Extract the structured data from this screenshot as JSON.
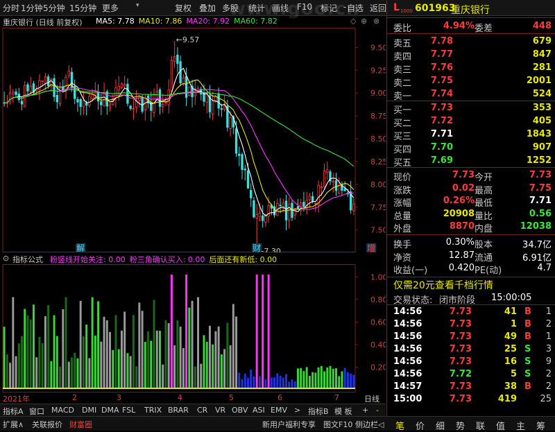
{
  "toolbar": {
    "tabs": [
      "分时",
      "1分钟",
      "5分钟",
      "15分钟",
      "更多"
    ],
    "more_arrow": "▾",
    "actions": [
      "复权",
      "叠加",
      "多股",
      "统计",
      "画线",
      "F10",
      "标记",
      "自选",
      "返回"
    ],
    "action_prefix": "-",
    "watermark": "www.goo.cn"
  },
  "chart_header": {
    "title": "重庆银行 (日线 前复权)",
    "ma": [
      {
        "label": "MA5: 7.78",
        "color": "#ffffff"
      },
      {
        "label": "MA10: 7.86",
        "color": "#e8e800"
      },
      {
        "label": "MA20: 7.92",
        "color": "#ff33ff"
      },
      {
        "label": "MA60: 7.82",
        "color": "#39e639"
      }
    ]
  },
  "chart_data": [
    {
      "type": "candlestick",
      "y_ticks": [
        9.5,
        9.25,
        9.0,
        8.75,
        8.5,
        8.25,
        8.0,
        7.75,
        7.5
      ],
      "ylim": [
        7.3,
        9.7
      ],
      "annotations": {
        "high": "9.57",
        "low": "7.30",
        "high_marker": "←9.57",
        "low_marker": "←7.30"
      },
      "markers": [
        "解",
        "财",
        "增"
      ],
      "n_bars": 120,
      "close_anchors": [
        [
          0,
          8.92
        ],
        [
          8,
          8.98
        ],
        [
          14,
          9.2
        ],
        [
          18,
          8.95
        ],
        [
          22,
          9.3
        ],
        [
          25,
          8.8
        ],
        [
          30,
          9.0
        ],
        [
          36,
          8.9
        ],
        [
          40,
          9.05
        ],
        [
          44,
          8.85
        ],
        [
          50,
          8.9
        ],
        [
          55,
          8.95
        ],
        [
          58,
          9.4
        ],
        [
          62,
          8.95
        ],
        [
          66,
          9.0
        ],
        [
          70,
          8.9
        ],
        [
          74,
          8.88
        ],
        [
          78,
          8.55
        ],
        [
          82,
          8.05
        ],
        [
          86,
          7.62
        ],
        [
          90,
          7.72
        ],
        [
          94,
          7.68
        ],
        [
          98,
          7.72
        ],
        [
          102,
          7.78
        ],
        [
          106,
          7.9
        ],
        [
          110,
          8.1
        ],
        [
          114,
          8.0
        ],
        [
          119,
          7.73
        ]
      ],
      "ma_colors": {
        "ma5": "#ffffff",
        "ma10": "#e8e800",
        "ma20": "#ff33ff",
        "ma60": "#39e639"
      }
    },
    {
      "type": "bar",
      "title": "指标公式",
      "legend": [
        {
          "label": "粉竖线开始关注: 0.00",
          "color": "#ff33ff"
        },
        {
          "label": "粉三角确认买入: 0.00",
          "color": "#ff33ff"
        },
        {
          "label": "后面还有新低: 0.00",
          "color": "#e8e800"
        }
      ],
      "y_ticks": [
        1.0,
        0.8,
        0.6,
        0.4,
        0.2
      ],
      "ylim": [
        0,
        1.1
      ],
      "pink_spikes": [
        57,
        62,
        86,
        88,
        90
      ],
      "x_labels": [
        "2021年",
        "2",
        "3",
        "4",
        "5",
        "6",
        "7"
      ]
    }
  ],
  "bottom_tabs": [
    "指标A",
    "窗口",
    "MACD",
    "DMI",
    "DMA",
    "FSL",
    "TRIX",
    "BRAR",
    "CR",
    "VR",
    "OBV",
    "ASI",
    "EMV",
    "指标B",
    "模 板",
    "+",
    "-"
  ],
  "bottom_arrow": ">",
  "x_range_label": "日线",
  "footer": {
    "left": [
      "扩展∧",
      "关联报价",
      "财富圈"
    ],
    "middle": [
      "新用户福利专享",
      "图文F10",
      "侧边栏◁"
    ],
    "right": [
      "笔",
      "价",
      "细",
      "势",
      "联",
      "值",
      "主",
      "筹"
    ]
  },
  "quote": {
    "code": "601963",
    "name": "重庆银行",
    "l_badge": "L",
    "l_sub": "1000",
    "weibi": {
      "label": "委比",
      "value": "4.94%",
      "diff_label": "委差",
      "diff": "448"
    },
    "asks": [
      {
        "label": "卖五",
        "price": "7.78",
        "vol": "679"
      },
      {
        "label": "卖四",
        "price": "7.77",
        "vol": "847"
      },
      {
        "label": "卖三",
        "price": "7.76",
        "vol": "281"
      },
      {
        "label": "卖二",
        "price": "7.75",
        "vol": "2001"
      },
      {
        "label": "卖一",
        "price": "7.74",
        "vol": "524"
      }
    ],
    "bids": [
      {
        "label": "买一",
        "price": "7.73",
        "vol": "353",
        "color": "#ff3b3b"
      },
      {
        "label": "买二",
        "price": "7.72",
        "vol": "405",
        "color": "#ff3b3b"
      },
      {
        "label": "买三",
        "price": "7.71",
        "vol": "1843",
        "color": "#ffffff"
      },
      {
        "label": "买四",
        "price": "7.70",
        "vol": "907",
        "color": "#39e639"
      },
      {
        "label": "买五",
        "price": "7.69",
        "vol": "1252",
        "color": "#39e639"
      }
    ],
    "stats": [
      {
        "l1": "现价",
        "v1": "7.73",
        "c1": "#ff3b3b",
        "l2": "今开",
        "v2": "7.73",
        "c2": "#ff3b3b"
      },
      {
        "l1": "涨跌",
        "v1": "0.02",
        "c1": "#ff3b3b",
        "l2": "最高",
        "v2": "7.75",
        "c2": "#ff3b3b"
      },
      {
        "l1": "涨幅",
        "v1": "0.26%",
        "c1": "#ff3b3b",
        "l2": "最低",
        "v2": "7.71",
        "c2": "#ffffff"
      },
      {
        "l1": "总量",
        "v1": "20908",
        "c1": "#e8e800",
        "l2": "量比",
        "v2": "0.56",
        "c2": "#39e639"
      },
      {
        "l1": "外盘",
        "v1": "8870",
        "c1": "#ff3b3b",
        "l2": "内盘",
        "v2": "12038",
        "c2": "#39e639"
      }
    ],
    "stats2": [
      {
        "l1": "换手",
        "v1": "0.30%",
        "l2": "股本",
        "v2": "34.7亿"
      },
      {
        "l1": "净资",
        "v1": "12.87",
        "l2": "流通",
        "v2": "6.91亿"
      },
      {
        "l1": "收益(一)",
        "v1": "0.420",
        "l2": "PE(动)",
        "v2": "4.7"
      }
    ],
    "promo": "仅需20元查看千档行情",
    "status": {
      "label": "交易状态:",
      "phase": "闭市阶段",
      "time": "15:00:05"
    },
    "ticks": [
      {
        "t": "14:56",
        "p": "7.73",
        "v": "41",
        "f": "B"
      },
      {
        "t": "14:56",
        "p": "7.73",
        "v": "1",
        "f": "B"
      },
      {
        "t": "14:56",
        "p": "7.73",
        "v": "49",
        "f": "B"
      },
      {
        "t": "14:56",
        "p": "7.73",
        "v": "25",
        "f": "S"
      },
      {
        "t": "14:56",
        "p": "7.73",
        "v": "16",
        "f": "S"
      },
      {
        "t": "14:56",
        "p": "7.72",
        "v": "5",
        "f": "S"
      },
      {
        "t": "14:57",
        "p": "7.73",
        "v": "38",
        "f": "B"
      },
      {
        "t": "15:00",
        "p": "7.73",
        "v": "419",
        "f": ""
      }
    ],
    "tick_counts": [
      "1",
      "2",
      "1",
      "3",
      "9",
      "2",
      "2",
      "25"
    ]
  }
}
